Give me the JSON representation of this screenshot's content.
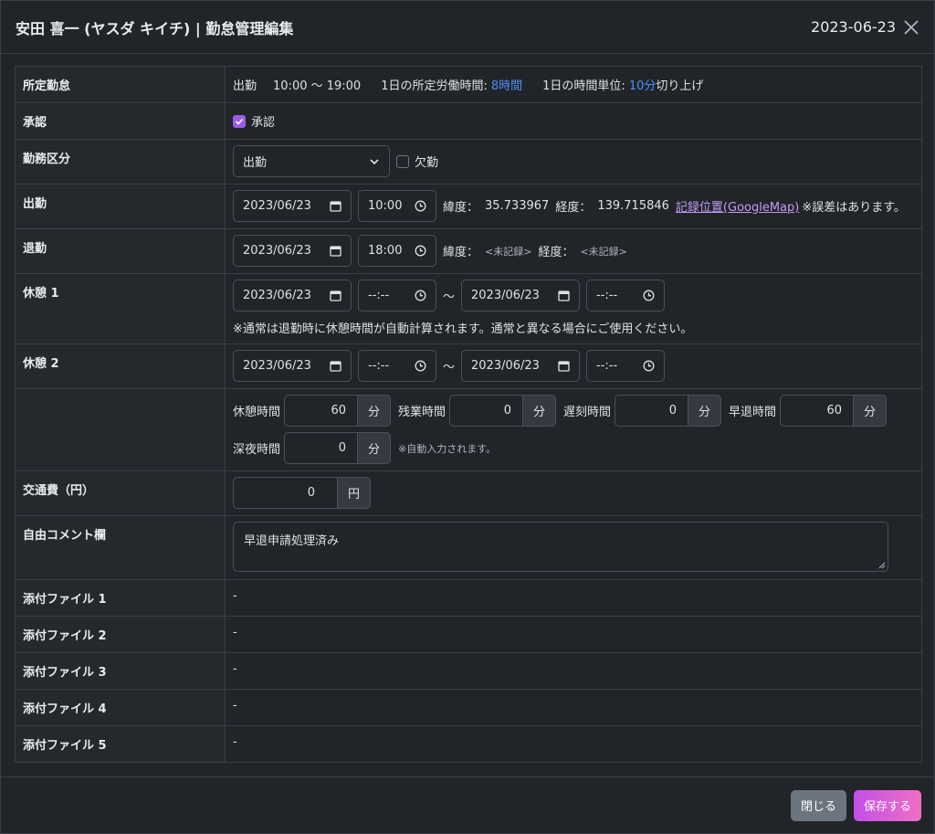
{
  "header": {
    "title": "安田 喜一 (ヤスダ キイチ) | 勤怠管理編集",
    "date": "2023-06-23"
  },
  "rows": {
    "scheduled": {
      "label": "所定勤怠",
      "type": "出勤",
      "hours": "10:00 〜 19:00",
      "work_label": "1日の所定労働時間:",
      "work_value": "8時間",
      "unit_label": "1日の時間単位:",
      "unit_value": "10分",
      "unit_suffix": "切り上げ"
    },
    "approval": {
      "label": "承認",
      "checkbox_label": "承認",
      "checked": true
    },
    "work_type": {
      "label": "勤務区分",
      "selected": "出勤",
      "absence_label": "欠勤",
      "absence_checked": false
    },
    "clock_in": {
      "label": "出勤",
      "date": "2023/06/23",
      "time": "10:00",
      "lat_label": "緯度：",
      "lat_value": "35.733967",
      "lng_label": "経度：",
      "lng_value": "139.715846",
      "map_link": "記録位置(GoogleMap)",
      "note": "※誤差はあります。"
    },
    "clock_out": {
      "label": "退勤",
      "date": "2023/06/23",
      "time": "18:00",
      "lat_label": "緯度：",
      "lat_value": "<未記録>",
      "lng_label": "経度：",
      "lng_value": "<未記録>"
    },
    "break1": {
      "label": "休憩 1",
      "start_date": "2023/06/23",
      "start_time": "--:--",
      "sep": "〜",
      "end_date": "2023/06/23",
      "end_time": "--:--",
      "note": "※通常は退勤時に休憩時間が自動計算されます。通常と異なる場合にご使用ください。"
    },
    "break2": {
      "label": "休憩 2",
      "start_date": "2023/06/23",
      "start_time": "--:--",
      "sep": "〜",
      "end_date": "2023/06/23",
      "end_time": "--:--"
    },
    "totals": {
      "unit": "分",
      "break_label": "休憩時間",
      "break_value": "60",
      "overtime_label": "残業時間",
      "overtime_value": "0",
      "late_label": "遅刻時間",
      "late_value": "0",
      "early_label": "早退時間",
      "early_value": "60",
      "night_label": "深夜時間",
      "night_value": "0",
      "auto_note": "※自動入力されます。"
    },
    "transport": {
      "label": "交通費（円）",
      "value": "0",
      "unit": "円"
    },
    "comment": {
      "label": "自由コメント欄",
      "value": "早退申請処理済み"
    },
    "attachments": [
      {
        "label": "添付ファイル 1",
        "value": "-"
      },
      {
        "label": "添付ファイル 2",
        "value": "-"
      },
      {
        "label": "添付ファイル 3",
        "value": "-"
      },
      {
        "label": "添付ファイル 4",
        "value": "-"
      },
      {
        "label": "添付ファイル 5",
        "value": "-"
      }
    ]
  },
  "footer": {
    "close_label": "閉じる",
    "save_label": "保存する"
  }
}
